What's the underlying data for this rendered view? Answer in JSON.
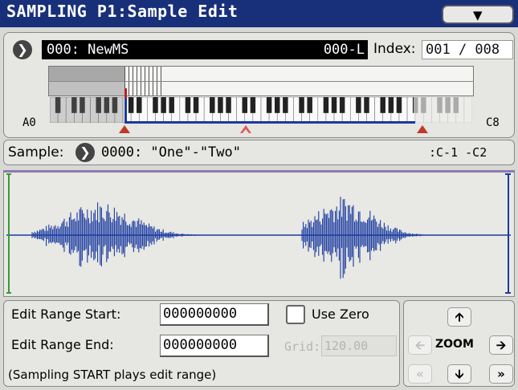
{
  "header": {
    "title": "SAMPLING P1:Sample Edit",
    "menu_icon": "chevron-down-icon"
  },
  "multisample": {
    "name": "000: NewMS",
    "suffix": "000-L",
    "index_label": "Index:",
    "index_value": "001 / 008",
    "low_key": "A0",
    "high_key": "C8"
  },
  "sample": {
    "label": "Sample:",
    "value": "0000: \"One\"-\"Two\"",
    "range": ":C-1 -C2"
  },
  "edit": {
    "start_label": "Edit Range Start:",
    "start_value": "000000000",
    "end_label": "Edit Range End:",
    "end_value": "000000000",
    "use_zero_label": "Use Zero",
    "use_zero_checked": false,
    "grid_label": "Grid:",
    "grid_value": "120.00",
    "note": "(Sampling START plays edit range)"
  },
  "zoom": {
    "label": "ZOOM",
    "up_icon": "arrow-up-icon",
    "down_icon": "arrow-down-icon",
    "left_icon": "arrow-left-icon",
    "right_icon": "arrow-right-icon",
    "fast_left_icon": "double-chevron-left-icon",
    "fast_right_icon": "double-chevron-right-icon"
  },
  "colors": {
    "title_bar": "#18307a",
    "waveform": "#1a3aa0",
    "marker": "#c0392b",
    "start_marker": "#3a9a3a"
  }
}
